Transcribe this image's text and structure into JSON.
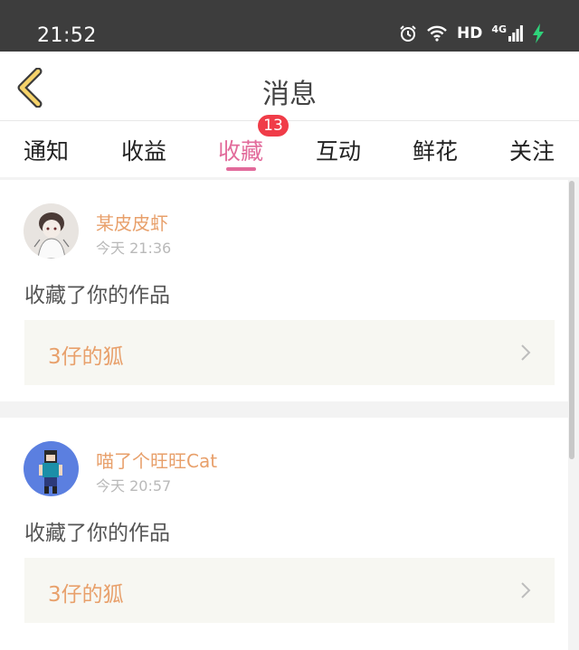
{
  "status_bar": {
    "time": "21:52",
    "hd": "HD",
    "network": "4G"
  },
  "header": {
    "title": "消息"
  },
  "tabs": [
    {
      "label": "通知"
    },
    {
      "label": "收益"
    },
    {
      "label": "收藏",
      "badge": "13"
    },
    {
      "label": "互动"
    },
    {
      "label": "鲜花"
    },
    {
      "label": "关注"
    }
  ],
  "active_tab": "收藏",
  "messages": [
    {
      "username": "某皮皮虾",
      "time": "今天 21:36",
      "action": "收藏了你的作品",
      "work_title": "3仔的狐"
    },
    {
      "username": "喵了个旺旺Cat",
      "time": "今天 20:57",
      "action": "收藏了你的作品",
      "work_title": "3仔的狐"
    }
  ],
  "colors": {
    "accent_pink": "#e26b9b",
    "name_orange": "#e8a06b",
    "badge_red": "#f03c48"
  }
}
